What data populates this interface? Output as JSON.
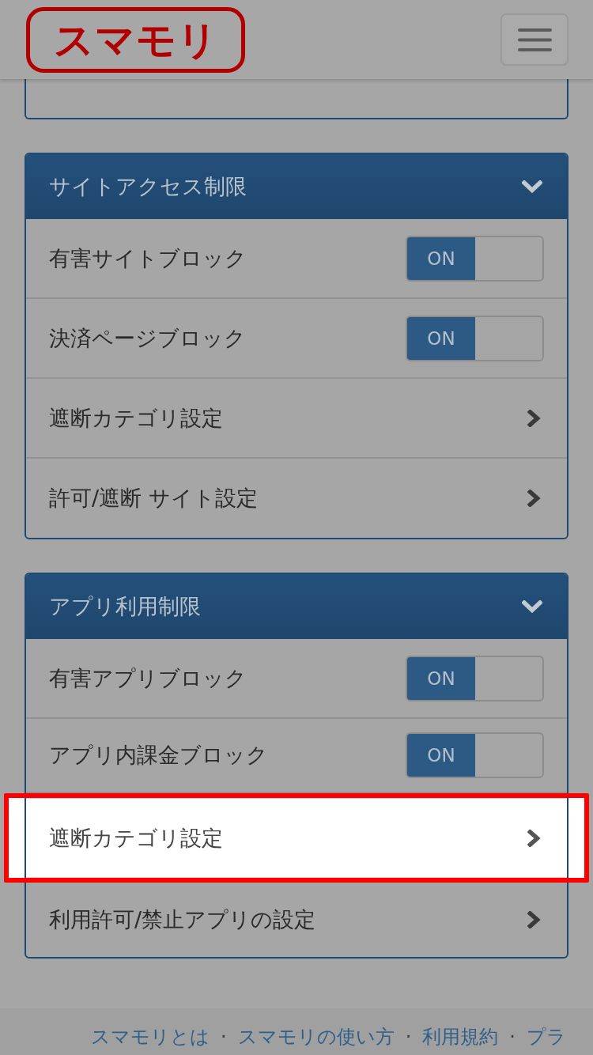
{
  "header": {
    "logo": "スマモリ"
  },
  "sections": [
    {
      "title": "サイトアクセス制限",
      "expanded": true,
      "rows": [
        {
          "kind": "toggle",
          "label": "有害サイトブロック",
          "on": true,
          "state_label": "ON",
          "highlighted": false
        },
        {
          "kind": "toggle",
          "label": "決済ページブロック",
          "on": true,
          "state_label": "ON",
          "highlighted": false
        },
        {
          "kind": "link",
          "label": "遮断カテゴリ設定",
          "highlighted": false
        },
        {
          "kind": "link",
          "label": "許可/遮断 サイト設定",
          "highlighted": false
        }
      ]
    },
    {
      "title": "アプリ利用制限",
      "expanded": true,
      "rows": [
        {
          "kind": "toggle",
          "label": "有害アプリブロック",
          "on": true,
          "state_label": "ON",
          "highlighted": false
        },
        {
          "kind": "toggle",
          "label": "アプリ内課金ブロック",
          "on": true,
          "state_label": "ON",
          "highlighted": false
        },
        {
          "kind": "link",
          "label": "遮断カテゴリ設定",
          "highlighted": true
        },
        {
          "kind": "link",
          "label": "利用許可/禁止アプリの設定",
          "highlighted": false
        }
      ]
    }
  ],
  "footer": {
    "links": [
      "スマモリとは",
      "スマモリの使い方",
      "利用規約",
      "プラ"
    ],
    "separators": [
      "·",
      "·",
      "·"
    ]
  }
}
